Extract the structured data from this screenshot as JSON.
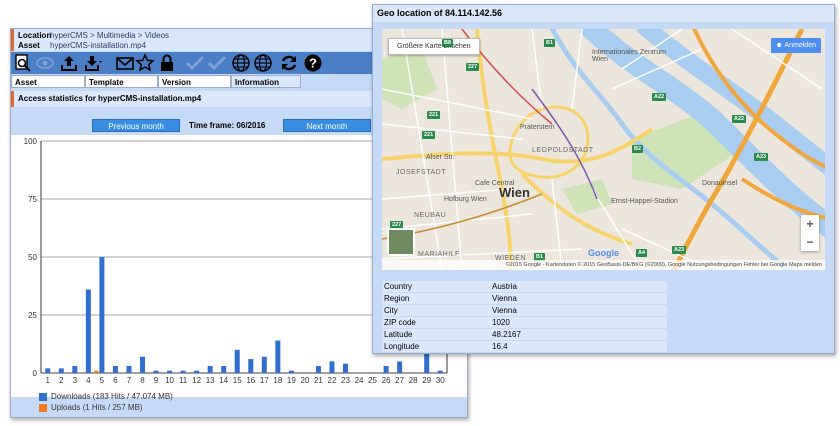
{
  "main": {
    "location_label": "Location",
    "location_value": "hyperCMS > Multimedia > Videos",
    "asset_label": "Asset",
    "asset_value": "hyperCMS-installation.mp4",
    "tabs": [
      {
        "label": "Asset"
      },
      {
        "label": "Template"
      },
      {
        "label": "Version"
      },
      {
        "label": "Information"
      }
    ],
    "toolbar_icons": [
      "preview-icon",
      "view-icon",
      "upload-icon",
      "download-icon",
      "mail-icon",
      "favorite-icon",
      "lock-icon",
      "checkin-icon",
      "publish-icon",
      "globe-icon",
      "globe-multi-icon",
      "refresh-icon",
      "help-icon"
    ],
    "section_title": "Access statistics for hyperCMS-installation.mp4",
    "prev_label": "Previous month",
    "next_label": "Next month",
    "time_frame": "Time frame: 06/2016",
    "legend_downloads": "Downloads (183 Hits / 47.074 MB)",
    "legend_uploads": "Uploads (1 Hits / 257 MB)"
  },
  "chart_data": {
    "type": "bar",
    "title": "",
    "xlabel": "",
    "ylabel": "",
    "categories": [
      "1",
      "2",
      "3",
      "4",
      "5",
      "6",
      "7",
      "8",
      "9",
      "10",
      "11",
      "12",
      "13",
      "14",
      "15",
      "16",
      "17",
      "18",
      "19",
      "20",
      "21",
      "22",
      "23",
      "24",
      "25",
      "26",
      "27",
      "28",
      "29",
      "30"
    ],
    "ylim": [
      0,
      100
    ],
    "yticks": [
      0,
      25,
      50,
      75,
      100
    ],
    "series": [
      {
        "name": "Downloads (183 Hits / 47.074 MB)",
        "color": "#2f6fcf",
        "values": [
          2,
          2,
          3,
          36,
          50,
          3,
          3,
          7,
          1,
          1,
          1,
          1,
          3,
          3,
          10,
          6,
          7,
          14,
          1,
          0,
          3,
          5,
          4,
          0,
          0,
          3,
          5,
          0,
          9,
          1
        ]
      },
      {
        "name": "Uploads (1 Hits / 257 MB)",
        "color": "#f07b1f",
        "values": [
          0,
          0,
          0,
          0,
          1,
          0,
          0,
          0,
          0,
          0,
          0,
          0,
          0,
          0,
          0,
          0,
          0,
          0,
          0,
          0,
          0,
          0,
          0,
          0,
          0,
          0,
          0,
          0,
          0,
          0
        ]
      }
    ],
    "grid": true,
    "legend": "bottom-left"
  },
  "geo": {
    "title": "Geo location of 84.114.142.56",
    "map_button": "Größere Karte ansehen",
    "map_login": "Anmelden",
    "zoom_in": "+",
    "zoom_out": "−",
    "attribution": "©2015 Google - Kartendaten © 2015 GeoBasis-DE/BKG (©2009), Google   Nutzungsbedingungen   Fehler bei Google Maps melden",
    "google_logo": "Google",
    "labels": {
      "wien": "Wien",
      "leopoldstadt": "LEOPOLDSTADT",
      "josefstadt": "JOSEFSTADT",
      "neubau": "NEUBAU",
      "mariahilf": "MARIAHILF",
      "wieden": "WIEDEN",
      "cafe": "Cafe Central",
      "hofburg": "Hofburg Wien",
      "stadion": "Ernst-Happel-Stadion",
      "donauinsel": "Donauinsel",
      "uno": "Internationales Zentrum Wien",
      "alserstr": "Alser Str.",
      "praterstern": "Praterstern"
    },
    "shields": [
      "227",
      "221",
      "221",
      "227",
      "A22",
      "A22",
      "A23",
      "A23",
      "A4",
      "B1",
      "B1",
      "B8",
      "B2"
    ],
    "rows": [
      {
        "key": "Country",
        "value": "Austria"
      },
      {
        "key": "Region",
        "value": "Vienna"
      },
      {
        "key": "City",
        "value": "Vienna"
      },
      {
        "key": "ZIP code",
        "value": "1020"
      },
      {
        "key": "Latitude",
        "value": "48.2167"
      },
      {
        "key": "Longitude",
        "value": "16.4"
      }
    ]
  }
}
